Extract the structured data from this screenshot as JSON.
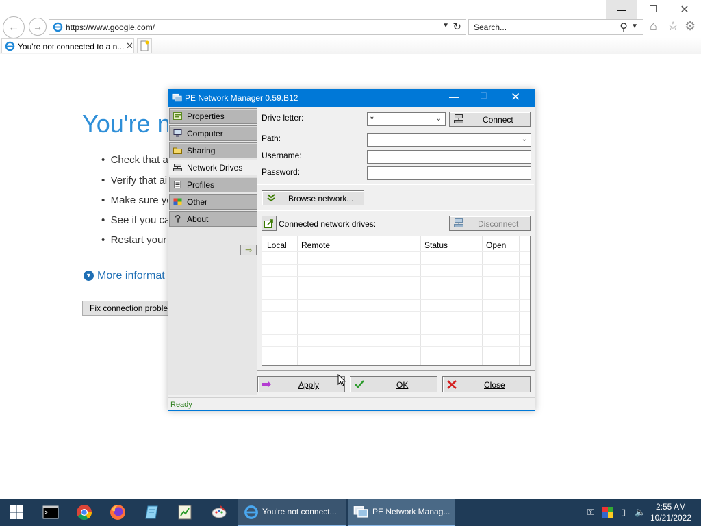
{
  "browser": {
    "address_url": "https://www.google.com/",
    "search_placeholder": "Search...",
    "tab_title": "You're not connected to a n..."
  },
  "page": {
    "title": "You're n",
    "bullets": [
      "Check that a",
      "Verify that ai",
      "Make sure yo",
      "See if you ca",
      "Restart your"
    ],
    "more_info": "More informat",
    "fix_button": "Fix connection proble"
  },
  "dialog": {
    "title": "PE Network Manager 0.59.B12",
    "tabs": [
      "Properties",
      "Computer",
      "Sharing",
      "Network Drives",
      "Profiles",
      "Other",
      "About"
    ],
    "active_tab": "Network Drives",
    "drive_letter_label": "Drive letter:",
    "drive_letter_value": "*",
    "connect_button": "Connect",
    "path_label": "Path:",
    "username_label": "Username:",
    "password_label": "Password:",
    "browse_button": "Browse network...",
    "connected_label": "Connected network drives:",
    "disconnect_button": "Disconnect",
    "columns": [
      "Local",
      "Remote",
      "Status",
      "Open"
    ],
    "apply_button": "Apply",
    "ok_button": "OK",
    "close_button": "Close",
    "status": "Ready"
  },
  "taskbar": {
    "tasks": [
      "You're not connect...",
      "PE Network Manag..."
    ],
    "time": "2:55 AM",
    "date": "10/21/2022"
  },
  "colors": {
    "accent": "#0078d7",
    "page_title": "#2f8fd8",
    "taskbar": "#1f3b57",
    "status_text": "#2f7f1f"
  }
}
